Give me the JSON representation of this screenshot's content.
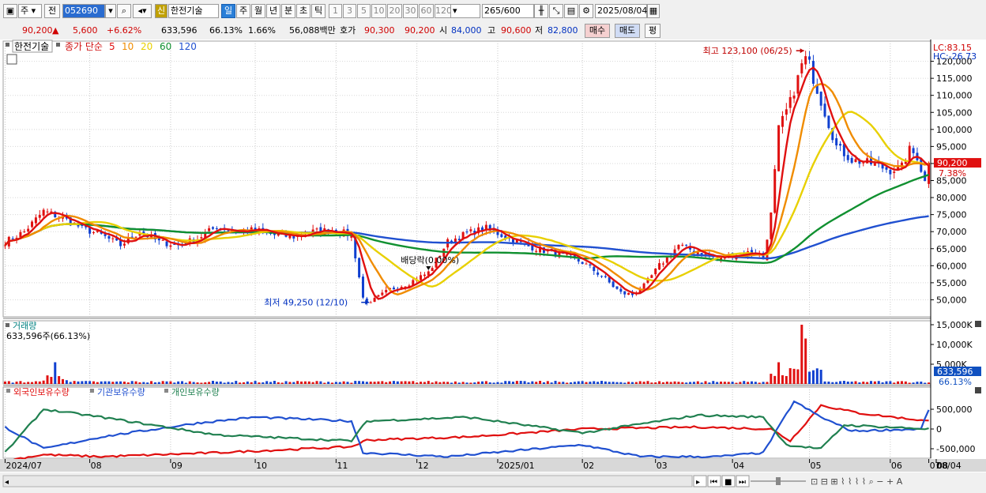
{
  "toolbar": {
    "market_type": "주",
    "prev_btn": "전",
    "code": "052690",
    "stock_badge": "신",
    "stock_name": "한전기술",
    "periods": [
      "일",
      "주",
      "월",
      "년",
      "분",
      "초",
      "틱"
    ],
    "active_period": "일",
    "minutes": [
      "1",
      "3",
      "5",
      "10",
      "20",
      "30",
      "60",
      "120"
    ],
    "count": "265",
    "count_max": "/600",
    "date": "2025/08/04"
  },
  "quote": {
    "price": "90,200",
    "change_arrow": "▲",
    "change": "5,600",
    "change_pct": "+6.62%",
    "volume": "633,596",
    "vol_ratio": "66.13%",
    "turnover": "1.66%",
    "amount": "56,088백만",
    "ask_label": "호가",
    "ask1": "90,300",
    "bid1": "90,200",
    "open_label": "시",
    "open": "84,000",
    "high_label": "고",
    "high": "90,600",
    "low_label": "저",
    "low": "82,800",
    "buy_btn": "매수",
    "sell_btn": "매도",
    "eval_btn": "평"
  },
  "chart_data": {
    "type": "line",
    "legend": {
      "stock": "한전기술",
      "ma_label": "종가 단순",
      "ma": [
        {
          "name": "5",
          "color": "#e01010"
        },
        {
          "name": "10",
          "color": "#f08c00"
        },
        {
          "name": "20",
          "color": "#e8d000"
        },
        {
          "name": "60",
          "color": "#109030"
        },
        {
          "name": "120",
          "color": "#2050d0"
        }
      ]
    },
    "x_ticks": [
      "2024/07",
      "08",
      "09",
      "10",
      "11",
      "12",
      "2025/01",
      "02",
      "03",
      "04",
      "05",
      "06",
      "07",
      "08",
      "08/04"
    ],
    "price_axis": {
      "ticks": [
        "120,000",
        "115,000",
        "110,000",
        "105,000",
        "100,000",
        "95,000",
        "90,000",
        "85,000",
        "80,000",
        "75,000",
        "70,000",
        "65,000",
        "60,000",
        "55,000",
        "50,000"
      ],
      "ylim": [
        45000,
        125000
      ]
    },
    "price_labels": {
      "lc": "LC:83.15",
      "hc": "HC:-26.73",
      "last": "90,200",
      "last_pct": "7.38%"
    },
    "annotations": {
      "high": "최고 123,100 (06/25)",
      "low": "최저 49,250 (12/10)",
      "dividend": "배당락(0.00%)"
    },
    "close_points": [
      [
        0,
        67000
      ],
      [
        5,
        70000
      ],
      [
        10,
        76000
      ],
      [
        15,
        74000
      ],
      [
        20,
        71000
      ],
      [
        25,
        69000
      ],
      [
        30,
        66000
      ],
      [
        35,
        70000
      ],
      [
        40,
        67000
      ],
      [
        45,
        66000
      ],
      [
        50,
        68000
      ],
      [
        55,
        71500
      ],
      [
        60,
        70000
      ],
      [
        65,
        70500
      ],
      [
        70,
        69000
      ],
      [
        75,
        68500
      ],
      [
        80,
        70000
      ],
      [
        85,
        70500
      ],
      [
        90,
        69000
      ],
      [
        93,
        50500
      ],
      [
        95,
        49250
      ],
      [
        100,
        53000
      ],
      [
        105,
        55000
      ],
      [
        110,
        58000
      ],
      [
        115,
        67000
      ],
      [
        120,
        69500
      ],
      [
        125,
        71000
      ],
      [
        130,
        68500
      ],
      [
        135,
        66000
      ],
      [
        140,
        64500
      ],
      [
        145,
        63000
      ],
      [
        150,
        61000
      ],
      [
        155,
        57000
      ],
      [
        160,
        52000
      ],
      [
        163,
        51500
      ],
      [
        166,
        54000
      ],
      [
        170,
        60000
      ],
      [
        175,
        66000
      ],
      [
        180,
        64000
      ],
      [
        185,
        62000
      ],
      [
        190,
        63500
      ],
      [
        195,
        64000
      ],
      [
        197,
        62000
      ],
      [
        199,
        75000
      ],
      [
        201,
        100000
      ],
      [
        204,
        108000
      ],
      [
        206,
        115000
      ],
      [
        208,
        123100
      ],
      [
        210,
        115000
      ],
      [
        213,
        105000
      ],
      [
        216,
        95000
      ],
      [
        220,
        91000
      ],
      [
        225,
        90000
      ],
      [
        230,
        88000
      ],
      [
        233,
        89000
      ],
      [
        235,
        94000
      ],
      [
        237,
        92000
      ],
      [
        239,
        84600
      ],
      [
        240,
        90200
      ]
    ],
    "volume_panel": {
      "title": "거래량",
      "value_text": "633,596주(66.13%)",
      "ticks": [
        "15,000K",
        "10,000K",
        "5,000K"
      ],
      "last": "633,596",
      "last_pct": "66.13%"
    },
    "holding_panel": {
      "series": [
        {
          "name": "외국인보유수량",
          "color": "#e01010"
        },
        {
          "name": "기관보유수량",
          "color": "#2050d0"
        },
        {
          "name": "개인보유수량",
          "color": "#208050"
        }
      ],
      "ticks": [
        "500,000",
        "0",
        "-500,000"
      ]
    }
  },
  "bottom": {
    "icons": [
      "play-right",
      "first",
      "stop",
      "last",
      "zoom-out",
      "zoom-in"
    ]
  }
}
